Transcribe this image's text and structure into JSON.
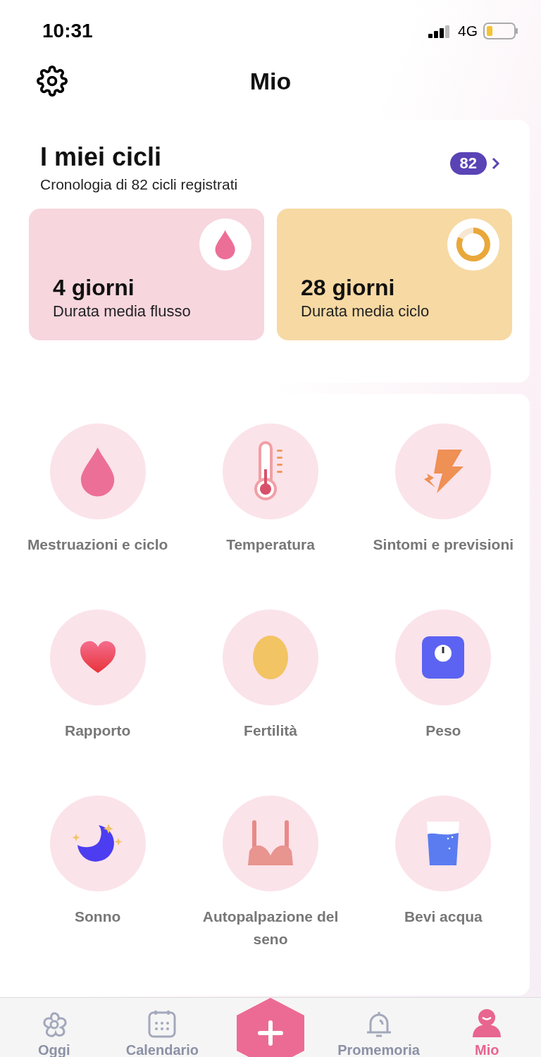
{
  "status_bar": {
    "time": "10:31",
    "network": "4G"
  },
  "header": {
    "title": "Mio"
  },
  "cycles": {
    "title": "I miei cicli",
    "subtitle": "Cronologia di 82 cicli registrati",
    "badge": "82",
    "stats": [
      {
        "value": "4 giorni",
        "label": "Durata media flusso",
        "color": "#f7d6de"
      },
      {
        "value": "28 giorni",
        "label": "Durata media ciclo",
        "color": "#f7d9a3"
      }
    ]
  },
  "features": [
    {
      "label": "Mestruazioni e ciclo"
    },
    {
      "label": "Temperatura"
    },
    {
      "label": "Sintomi e previsioni"
    },
    {
      "label": "Rapporto"
    },
    {
      "label": "Fertilità"
    },
    {
      "label": "Peso"
    },
    {
      "label": "Sonno"
    },
    {
      "label": "Autopalpazione del seno"
    },
    {
      "label": "Bevi acqua"
    }
  ],
  "tab_bar": [
    {
      "label": "Oggi",
      "selected": false
    },
    {
      "label": "Calendario",
      "selected": false
    },
    {
      "kind": "add"
    },
    {
      "label": "Promemoria",
      "selected": false
    },
    {
      "label": "Mio",
      "selected": true
    }
  ]
}
